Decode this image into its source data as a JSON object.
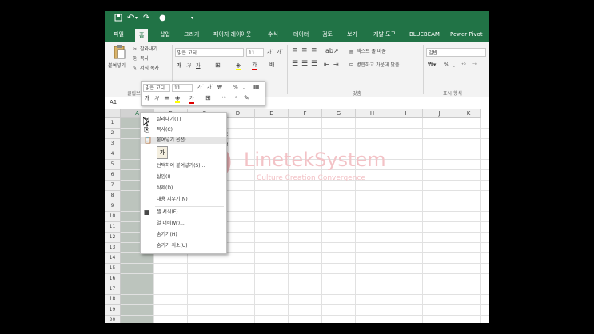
{
  "qat": {
    "undo": "↶",
    "redo": "↷",
    "more": "▾"
  },
  "tabs": [
    "파일",
    "홈",
    "삽입",
    "그리기",
    "페이지 레이아웃",
    "수식",
    "데이터",
    "검토",
    "보기",
    "개발 도구",
    "BLUEBEAM",
    "Power Pivot"
  ],
  "ribbon": {
    "paste": "붙여넣기",
    "cut": "잘라내기",
    "copy": "복사",
    "format_painter": "서식 복사",
    "clipboard_group": "클립보드",
    "font_name": "맑은 고딕",
    "font_size": "11",
    "wrap_text": "텍스트 줄 바꿈",
    "merge_center": "병합하고 가운데 맞춤",
    "align_group": "맞춤",
    "number_format": "일반",
    "number_group": "표시 형식"
  },
  "name_box": "A1",
  "columns": [
    "A",
    "B",
    "C",
    "D",
    "E",
    "F",
    "G",
    "H",
    "I",
    "J",
    "K"
  ],
  "rows": [
    "1",
    "2",
    "3",
    "4",
    "5",
    "6",
    "7",
    "8",
    "9",
    "10",
    "11",
    "12",
    "13",
    "14",
    "15",
    "16",
    "17",
    "18",
    "19",
    "20"
  ],
  "cell_values": [
    "1",
    "2",
    "3",
    "4",
    "5"
  ],
  "mini_toolbar": {
    "font_name": "맑은 고디",
    "font_size": "11"
  },
  "context_menu": {
    "cut": "잘라내기(T)",
    "copy": "복사(C)",
    "paste_options": "붙여넣기 옵션:",
    "paste_special": "선택하여 붙여넣기(S)...",
    "insert": "삽입(I)",
    "delete": "삭제(D)",
    "clear": "내용 지우기(N)",
    "format_cells": "셀 서식(F)...",
    "column_width": "열 너비(W)...",
    "hide": "숨기기(H)",
    "unhide": "숨기기 취소(U)"
  },
  "watermark": {
    "brand": "LinetekSystem",
    "tagline": "Culture Creation Convergence"
  },
  "colors": {
    "accent": "#217346",
    "watermark": "#e05560"
  }
}
